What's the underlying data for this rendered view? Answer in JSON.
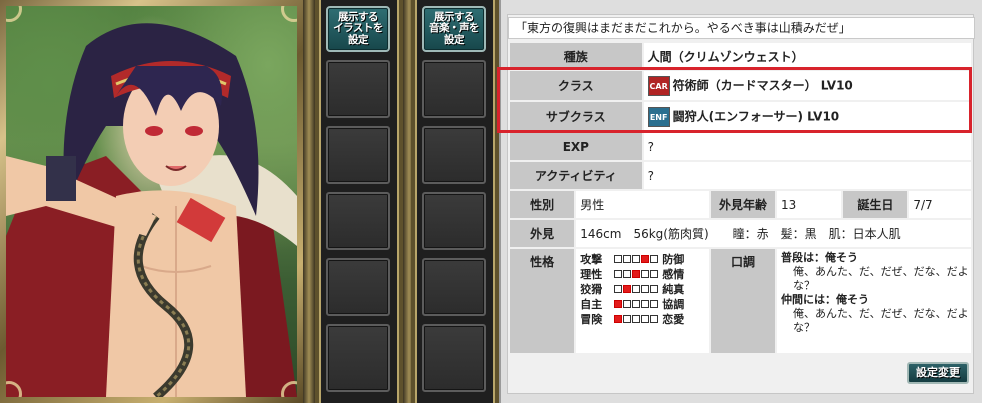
{
  "illustration_button": {
    "line1": "展示する",
    "line2": "イラストを",
    "line3": "設定"
  },
  "music_button": {
    "line1": "展示する",
    "line2": "音楽・声を",
    "line3": "設定"
  },
  "quote": "「東方の復興はまだまだこれから。やるべき事は山積みだぜ」",
  "race": {
    "label": "種族",
    "value": "人間（クリムゾンウェスト）"
  },
  "class": {
    "label": "クラス",
    "icon_text": "CAR",
    "icon_color": "#b12424",
    "value": "符術師（カードマスター） LV10"
  },
  "subclass": {
    "label": "サブクラス",
    "icon_text": "ENF",
    "icon_color": "#2a6f8f",
    "value": "闘狩人(エンフォーサー) LV10"
  },
  "exp": {
    "label": "EXP",
    "value": "?"
  },
  "activity": {
    "label": "アクティビティ",
    "value": "?"
  },
  "gender": {
    "label": "性別",
    "value": "男性"
  },
  "apparent_age": {
    "label": "外見年齢",
    "value": "13"
  },
  "birthday": {
    "label": "誕生日",
    "value": "7/7"
  },
  "appearance": {
    "label": "外見",
    "value": "146cm　56kg(筋肉質)　　瞳：赤　髪：黒　肌：日本人肌"
  },
  "personality": {
    "label": "性格",
    "rows": [
      {
        "left": "攻撃",
        "right": "防御",
        "filled": 4
      },
      {
        "left": "理性",
        "right": "感情",
        "filled": 3
      },
      {
        "left": "狡猾",
        "right": "純真",
        "filled": 2
      },
      {
        "left": "自主",
        "right": "協調",
        "filled": 1
      },
      {
        "left": "冒険",
        "right": "恋愛",
        "filled": 1
      }
    ]
  },
  "speech": {
    "label": "口調",
    "normal_title": "普段は：俺そう",
    "normal_text": "俺、あんた、だ、だぜ、だな、だよな？",
    "friends_title": "仲間には：俺そう",
    "friends_text": "俺、あんた、だ、だぜ、だな、だよな？"
  },
  "settings_button": "設定変更",
  "colors": {
    "highlight": "#d8232c",
    "panel_bg": "#f0f0f0",
    "button_teal": "#2d6167"
  }
}
